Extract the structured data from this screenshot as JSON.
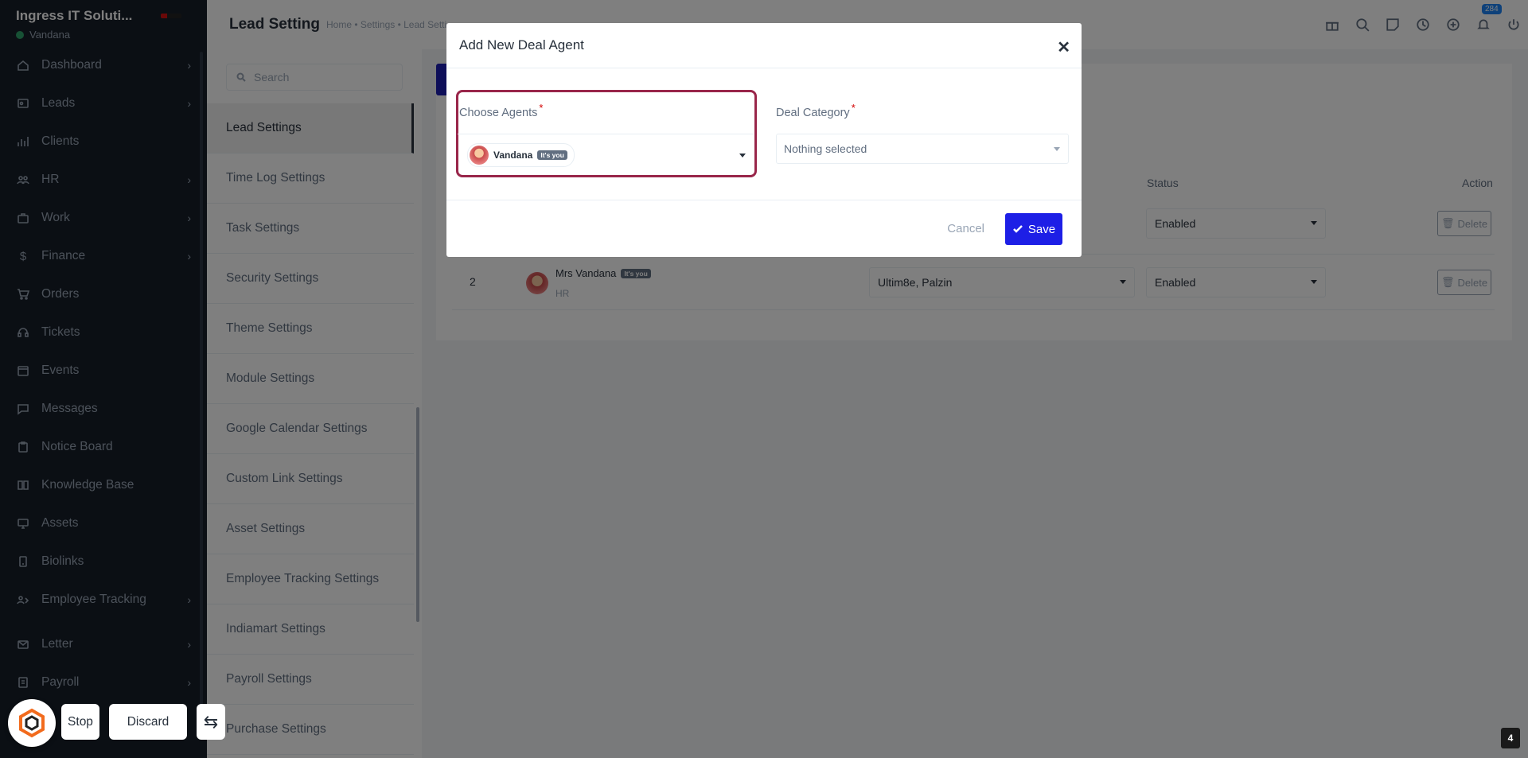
{
  "sidebar": {
    "company": "Ingress IT Soluti...",
    "user": "Vandana",
    "items": [
      {
        "label": "Dashboard",
        "icon": "home-icon",
        "has_children": true
      },
      {
        "label": "Leads",
        "icon": "leads-icon",
        "has_children": true
      },
      {
        "label": "Clients",
        "icon": "clients-icon",
        "has_children": false
      },
      {
        "label": "HR",
        "icon": "users-icon",
        "has_children": true
      },
      {
        "label": "Work",
        "icon": "briefcase-icon",
        "has_children": true
      },
      {
        "label": "Finance",
        "icon": "dollar-icon",
        "has_children": true
      },
      {
        "label": "Orders",
        "icon": "cart-icon",
        "has_children": false
      },
      {
        "label": "Tickets",
        "icon": "headset-icon",
        "has_children": false
      },
      {
        "label": "Events",
        "icon": "calendar-icon",
        "has_children": false
      },
      {
        "label": "Messages",
        "icon": "message-icon",
        "has_children": false
      },
      {
        "label": "Notice Board",
        "icon": "clipboard-icon",
        "has_children": false
      },
      {
        "label": "Knowledge Base",
        "icon": "book-icon",
        "has_children": false
      },
      {
        "label": "Assets",
        "icon": "monitor-icon",
        "has_children": false
      },
      {
        "label": "Biolinks",
        "icon": "link-icon",
        "has_children": false
      },
      {
        "label": "Employee Tracking",
        "icon": "tracking-icon",
        "has_children": true
      },
      {
        "label": "Letter",
        "icon": "mail-icon",
        "has_children": true
      },
      {
        "label": "Payroll",
        "icon": "payroll-icon",
        "has_children": true
      }
    ]
  },
  "header": {
    "title": "Lead Setting",
    "breadcrumb": "Home • Settings • Lead Setti",
    "notification_count": "284"
  },
  "settings_panel": {
    "search_placeholder": "Search",
    "items": [
      "Lead Settings",
      "Time Log Settings",
      "Task Settings",
      "Security Settings",
      "Theme Settings",
      "Module Settings",
      "Google Calendar Settings",
      "Custom Link Settings",
      "Asset Settings",
      "Employee Tracking Settings",
      "Indiamart Settings",
      "Payroll Settings",
      "Purchase Settings"
    ],
    "active_index": 0
  },
  "table": {
    "headers": {
      "status": "Status",
      "action": "Action"
    },
    "rows": [
      {
        "num": "",
        "name": "",
        "tag": "",
        "role": "",
        "category": "",
        "status": "Enabled",
        "action": "Delete"
      },
      {
        "num": "2",
        "name": "Mrs Vandana",
        "tag": "It's you",
        "role": "HR",
        "category": "Ultim8e, Palzin",
        "status": "Enabled",
        "action": "Delete"
      }
    ]
  },
  "modal": {
    "title": "Add New Deal Agent",
    "agents_label": "Choose Agents",
    "required_mark": "*",
    "selected_agent": "Vandana",
    "selected_agent_tag": "It's you",
    "category_label": "Deal Category",
    "category_placeholder": "Nothing selected",
    "cancel_label": "Cancel",
    "save_label": "Save"
  },
  "recorder": {
    "stop_label": "Stop",
    "discard_label": "Discard"
  },
  "page_badge": "4"
}
